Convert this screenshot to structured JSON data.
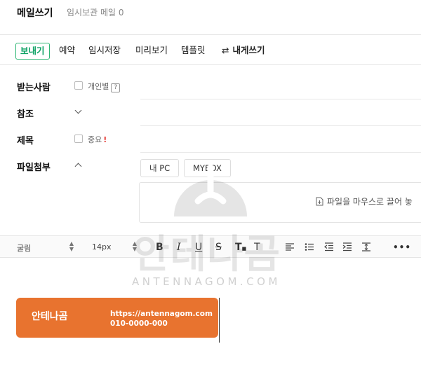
{
  "header": {
    "title": "메일쓰기",
    "draft_label": "임시보관 메일 0"
  },
  "toolbar": {
    "send": "보내기",
    "reserve": "예약",
    "save_draft": "임시저장",
    "preview": "미리보기",
    "template": "템플릿",
    "write_to_self": "내게쓰기"
  },
  "fields": {
    "to_label": "받는사람",
    "individual_label": "개인별",
    "help_mark": "?",
    "cc_label": "참조",
    "subject_label": "제목",
    "important_label": "중요",
    "important_mark": "!",
    "attach_label": "파일첨부",
    "my_pc": "내 PC",
    "mybox": "MYBOX",
    "drop_text": "파일을 마우스로 끌어 놓"
  },
  "editor": {
    "font": "굴림",
    "size": "14px"
  },
  "signature": {
    "name": "안테나곰",
    "url": "https://antennagom.com",
    "phone": "010-0000-000"
  },
  "watermark": {
    "text": "안테나곰",
    "sub": "ANTENNAGOM.COM"
  },
  "colors": {
    "accent_green": "#0ba163",
    "signature_bg": "#e8732f",
    "important_red": "#e53935"
  }
}
